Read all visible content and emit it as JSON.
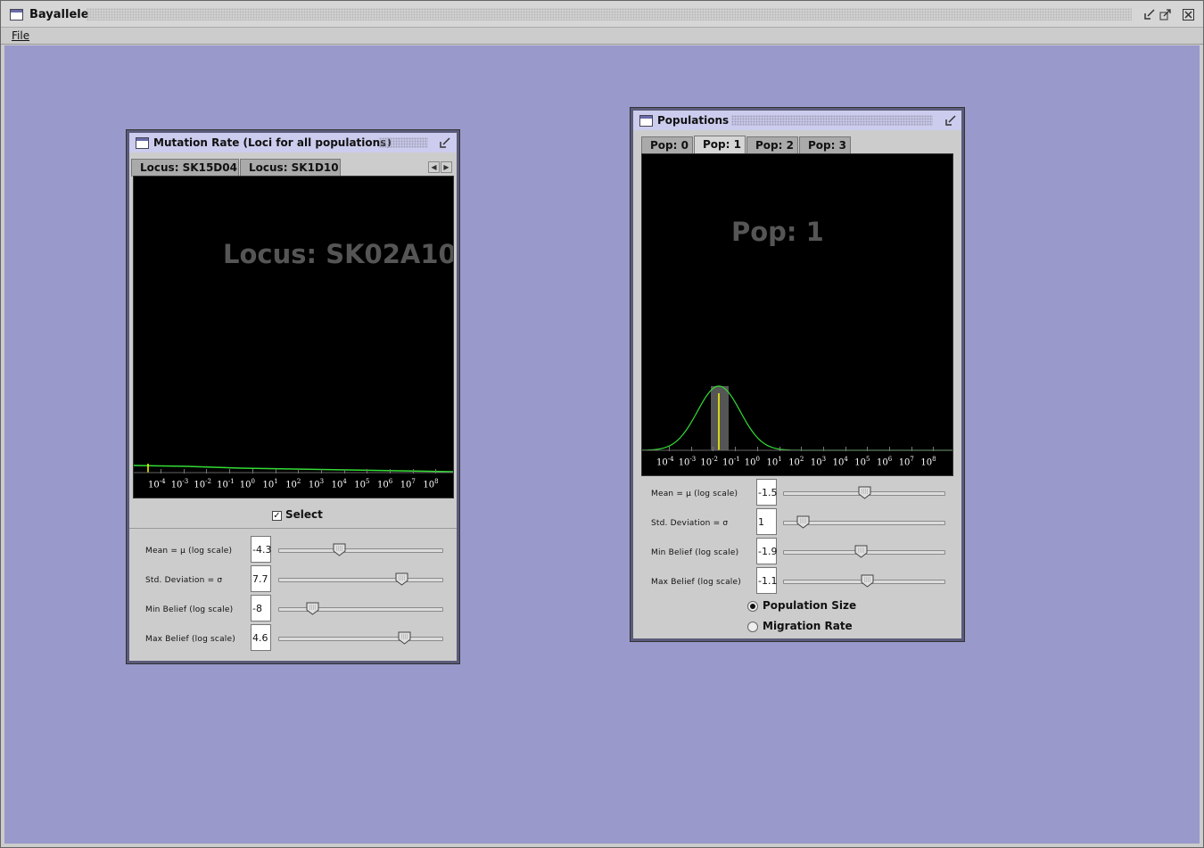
{
  "app": {
    "title": "Bayallele",
    "menu": {
      "file": "File"
    }
  },
  "mutation_window": {
    "title": "Mutation Rate (Loci for all populations)",
    "tabs": [
      {
        "label": "Locus: SK15D04",
        "active": false
      },
      {
        "label": "Locus: SK1D10",
        "active": false
      }
    ],
    "watermark": "Locus: SK02A10",
    "axis_ticks": [
      "10",
      "10",
      "10",
      "10",
      "10",
      "10",
      "10",
      "10",
      "10",
      "10",
      "10",
      "10",
      "10"
    ],
    "axis_exponents": [
      "-4",
      "-3",
      "-2",
      "-1",
      "0",
      "1",
      "2",
      "3",
      "4",
      "5",
      "6",
      "7",
      "8"
    ],
    "select_label": "Select",
    "select_checked": true,
    "params": [
      {
        "label": "Mean = μ (log scale)",
        "value": "-4.3",
        "slider_fraction": 0.36
      },
      {
        "label": "Std. Deviation = σ",
        "value": "7.7",
        "slider_fraction": 0.77
      },
      {
        "label": "Min Belief (log scale)",
        "value": "-8",
        "slider_fraction": 0.18
      },
      {
        "label": "Max Belief (log scale)",
        "value": "4.6",
        "slider_fraction": 0.79
      }
    ]
  },
  "populations_window": {
    "title": "Populations",
    "tabs": [
      {
        "label": "Pop: 0",
        "active": false
      },
      {
        "label": "Pop: 1",
        "active": true
      },
      {
        "label": "Pop: 2",
        "active": false
      },
      {
        "label": "Pop: 3",
        "active": false
      }
    ],
    "watermark": "Pop: 1",
    "axis_ticks": [
      "10",
      "10",
      "10",
      "10",
      "10",
      "10",
      "10",
      "10",
      "10",
      "10",
      "10",
      "10",
      "10"
    ],
    "axis_exponents": [
      "-4",
      "-3",
      "-2",
      "-1",
      "0",
      "1",
      "2",
      "3",
      "4",
      "5",
      "6",
      "7",
      "8"
    ],
    "params": [
      {
        "label": "Mean = μ (log scale)",
        "value": "-1.5",
        "slider_fraction": 0.5
      },
      {
        "label": "Std. Deviation = σ",
        "value": "1",
        "slider_fraction": 0.09
      },
      {
        "label": "Min Belief (log scale)",
        "value": "-1.9",
        "slider_fraction": 0.48
      },
      {
        "label": "Max Belief (log scale)",
        "value": "-1.1",
        "slider_fraction": 0.52
      }
    ],
    "radio_options": [
      {
        "label": "Population Size",
        "selected": true
      },
      {
        "label": "Migration Rate",
        "selected": false
      }
    ]
  },
  "colors": {
    "desktop": "#9999cc",
    "curve": "#33dd33",
    "mean_line": "#ffff00",
    "belief_band": "#555555"
  }
}
